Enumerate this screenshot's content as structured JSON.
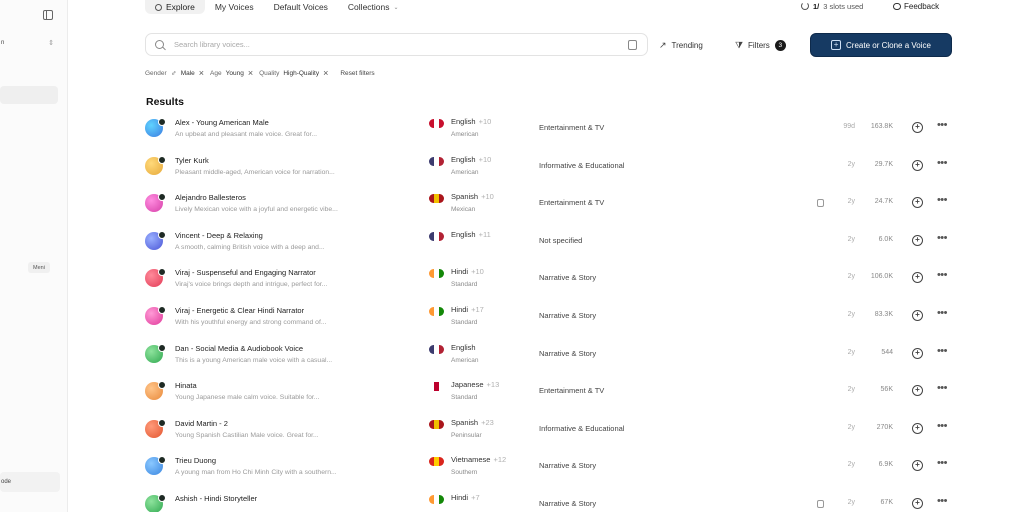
{
  "sidebar": {
    "select_value": "n",
    "select_arrow": "⇕",
    "badge": "Meni",
    "bottom_label": "ode"
  },
  "nav": {
    "tabs": [
      {
        "label": "Explore"
      },
      {
        "label": "My Voices"
      },
      {
        "label": "Default Voices"
      },
      {
        "label": "Collections"
      }
    ],
    "credits_count": "1/",
    "credits_text": "3 slots used",
    "feedback": "Feedback"
  },
  "search": {
    "placeholder": "Search library voices..."
  },
  "toolbar": {
    "trending": "Trending",
    "filters": "Filters",
    "filter_count": "3",
    "create": "Create or Clone a Voice"
  },
  "chips": {
    "gender_label": "Gender",
    "gender_value": "Male",
    "age_label": "Age",
    "age_value": "Young",
    "quality_label": "Quality",
    "quality_value": "High-Quality",
    "reset": "Reset filters"
  },
  "results_title": "Results",
  "colors": {
    "primary_button": "#163a63"
  },
  "voices": [
    {
      "name": "Alex - Young American Male",
      "desc": "An upbeat and pleasant male voice. Great for...",
      "lang": "English",
      "more": "+10",
      "accent": "American",
      "category": "Entertainment & TV",
      "age": "99d",
      "users": "163.8K",
      "avatar": [
        "#3b7be0",
        "#5fd3ff"
      ],
      "flag": [
        "#c8102e",
        "#ffffff",
        "#c8102e"
      ],
      "copy": false
    },
    {
      "name": "Tyler Kurk",
      "desc": "Pleasant middle-aged, American voice for narration...",
      "lang": "English",
      "more": "+10",
      "accent": "American",
      "category": "Informative & Educational",
      "age": "2y",
      "users": "29.7K",
      "avatar": [
        "#e6a93a",
        "#ffd97a"
      ],
      "flag": [
        "#3c3b6e",
        "#ffffff",
        "#b22234"
      ],
      "copy": false
    },
    {
      "name": "Alejandro Ballesteros",
      "desc": "Lively Mexican voice with a joyful and energetic vibe...",
      "lang": "Spanish",
      "more": "+10",
      "accent": "Mexican",
      "category": "Entertainment & TV",
      "age": "2y",
      "users": "24.7K",
      "avatar": [
        "#d63fa8",
        "#ff8de0"
      ],
      "flag": [
        "#aa151b",
        "#f1bf00",
        "#aa151b"
      ],
      "copy": true
    },
    {
      "name": "Vincent - Deep & Relaxing",
      "desc": "A smooth, calming British voice with a deep and...",
      "lang": "English",
      "more": "+11",
      "accent": "",
      "category": "Not specified",
      "age": "2y",
      "users": "6.0K",
      "avatar": [
        "#4a55d6",
        "#9ab0ff"
      ],
      "flag": [
        "#3c3b6e",
        "#ffffff",
        "#b22234"
      ],
      "copy": false
    },
    {
      "name": "Viraj - Suspenseful and Engaging Narrator",
      "desc": "Viraj's voice brings depth and intrigue, perfect for...",
      "lang": "Hindi",
      "more": "+10",
      "accent": "Standard",
      "category": "Narrative & Story",
      "age": "2y",
      "users": "106.0K",
      "avatar": [
        "#e23a55",
        "#ff8a9a"
      ],
      "flag": [
        "#ff9933",
        "#ffffff",
        "#138808"
      ],
      "copy": false
    },
    {
      "name": "Viraj - Energetic & Clear Hindi Narrator",
      "desc": "With his youthful energy and strong command of...",
      "lang": "Hindi",
      "more": "+17",
      "accent": "Standard",
      "category": "Narrative & Story",
      "age": "2y",
      "users": "83.3K",
      "avatar": [
        "#e0389a",
        "#ff9ad6"
      ],
      "flag": [
        "#ff9933",
        "#ffffff",
        "#138808"
      ],
      "copy": false
    },
    {
      "name": "Dan - Social Media & Audiobook Voice",
      "desc": "This is a young American male voice with a casual...",
      "lang": "English",
      "more": "",
      "accent": "American",
      "category": "Narrative & Story",
      "age": "2y",
      "users": "544",
      "avatar": [
        "#2fa84f",
        "#8ee39d"
      ],
      "flag": [
        "#3c3b6e",
        "#ffffff",
        "#b22234"
      ],
      "copy": false
    },
    {
      "name": "Hinata",
      "desc": "Young Japanese male calm voice. Suitable for...",
      "lang": "Japanese",
      "more": "+13",
      "accent": "Standard",
      "category": "Entertainment & TV",
      "age": "2y",
      "users": "56K",
      "avatar": [
        "#e8893a",
        "#ffc58a"
      ],
      "flag": [
        "#ffffff",
        "#bc002d",
        "#ffffff"
      ],
      "copy": false
    },
    {
      "name": "David Martin - 2",
      "desc": "Young Spanish Castilian Male voice. Great for...",
      "lang": "Spanish",
      "more": "+23",
      "accent": "Peninsular",
      "category": "Informative & Educational",
      "age": "2y",
      "users": "270K",
      "avatar": [
        "#e2552f",
        "#ff9a7a"
      ],
      "flag": [
        "#aa151b",
        "#f1bf00",
        "#aa151b"
      ],
      "copy": false
    },
    {
      "name": "Trieu Duong",
      "desc": "A young man from Ho Chi Minh City with a southern...",
      "lang": "Vietnamese",
      "more": "+12",
      "accent": "Southern",
      "category": "Narrative & Story",
      "age": "2y",
      "users": "6.9K",
      "avatar": [
        "#3a86e0",
        "#8ac8ff"
      ],
      "flag": [
        "#da251d",
        "#ffcd00",
        "#da251d"
      ],
      "copy": false
    },
    {
      "name": "Ashish - Hindi Storyteller",
      "desc": "",
      "lang": "Hindi",
      "more": "+7",
      "accent": "",
      "category": "Narrative & Story",
      "age": "2y",
      "users": "67K",
      "avatar": [
        "#2fa84f",
        "#8ee39d"
      ],
      "flag": [
        "#ff9933",
        "#ffffff",
        "#138808"
      ],
      "copy": true
    }
  ]
}
